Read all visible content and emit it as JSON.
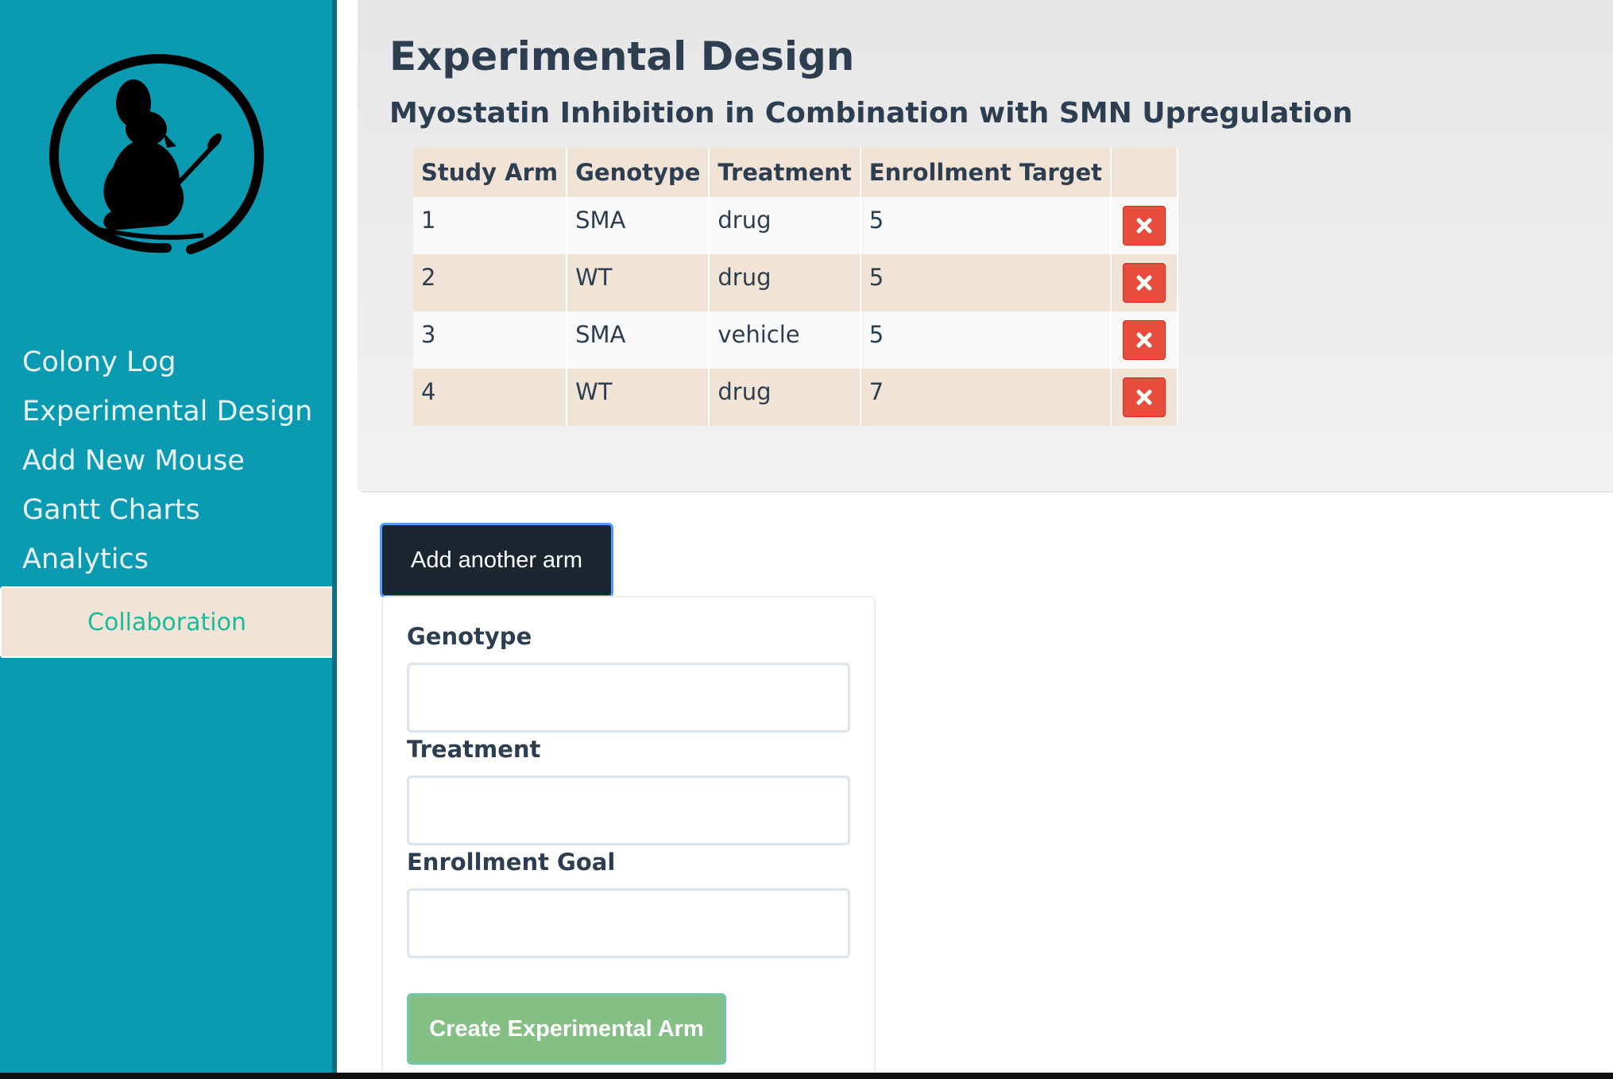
{
  "sidebar": {
    "logo_icon": "mouse-with-paintbrush-icon",
    "nav": [
      {
        "label": "Colony Log"
      },
      {
        "label": "Experimental Design"
      },
      {
        "label": "Add New Mouse"
      },
      {
        "label": "Gantt Charts"
      },
      {
        "label": "Analytics"
      }
    ],
    "active_item": {
      "label": "Collaboration"
    }
  },
  "header": {
    "title": "Experimental Design",
    "subtitle": "Myostatin Inhibition in Combination with SMN Upregulation"
  },
  "table": {
    "columns": [
      "Study Arm",
      "Genotype",
      "Treatment",
      "Enrollment Target",
      ""
    ],
    "rows": [
      {
        "arm": "1",
        "genotype": "SMA",
        "treatment": "drug",
        "target": "5"
      },
      {
        "arm": "2",
        "genotype": "WT",
        "treatment": "drug",
        "target": "5"
      },
      {
        "arm": "3",
        "genotype": "SMA",
        "treatment": "vehicle",
        "target": "5"
      },
      {
        "arm": "4",
        "genotype": "WT",
        "treatment": "drug",
        "target": "7"
      }
    ],
    "delete_icon": "close-icon"
  },
  "add_arm": {
    "label": "Add another arm"
  },
  "form": {
    "genotype_label": "Genotype",
    "genotype_value": "",
    "treatment_label": "Treatment",
    "treatment_value": "",
    "enrollment_label": "Enrollment Goal",
    "enrollment_value": "",
    "submit_label": "Create Experimental Arm"
  },
  "colors": {
    "sidebar": "#0a9bb3",
    "accent": "#18bc9c",
    "danger": "#e74c3c",
    "dark_button": "#1b2631",
    "success_button": "#86bf86",
    "table_highlight": "#f1e3d6"
  }
}
